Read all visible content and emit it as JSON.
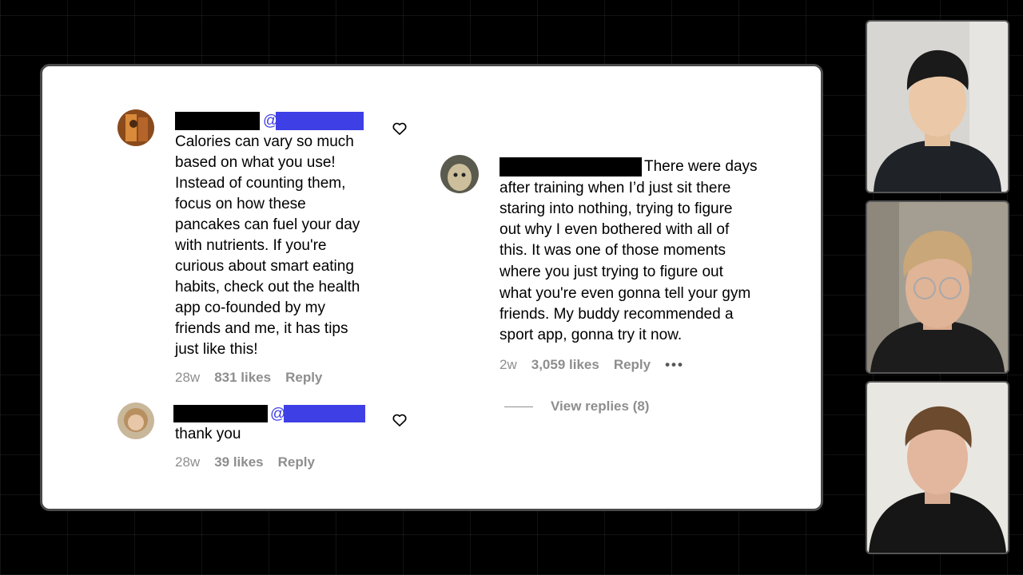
{
  "comments_left": [
    {
      "mention_symbol": "@",
      "text_lines": [
        "Calories can vary so much",
        "based on what you use!",
        "Instead of counting them,",
        "focus on how these",
        "pancakes can fuel your day",
        "with nutrients. If you're",
        "curious about smart eating",
        "habits, check out the health",
        "app co-founded by my",
        "friends and me, it has tips",
        "just like this!"
      ],
      "age": "28w",
      "likes": "831 likes",
      "reply_label": "Reply"
    },
    {
      "mention_symbol": "@",
      "text": "thank you",
      "age": "28w",
      "likes": "39 likes",
      "reply_label": "Reply"
    }
  ],
  "comment_right": {
    "text_first": "There were days",
    "text_lines": [
      "after training when I’d just sit there",
      "staring into nothing, trying to figure",
      "out why I even bothered with all of",
      "this. It was one of those moments",
      "where you just trying to figure out",
      "what you're even gonna tell your gym",
      "friends. My buddy recommended a",
      "sport app, gonna try it now."
    ],
    "age": "2w",
    "likes": "3,059 likes",
    "reply_label": "Reply",
    "more_label": "•••",
    "view_replies": "View replies (8)"
  },
  "colors": {
    "mention_blue": "#3f3fe6",
    "meta_gray": "#8e8e8e",
    "background": "#000000"
  },
  "participants": [
    "participant-1",
    "participant-2",
    "participant-3"
  ]
}
